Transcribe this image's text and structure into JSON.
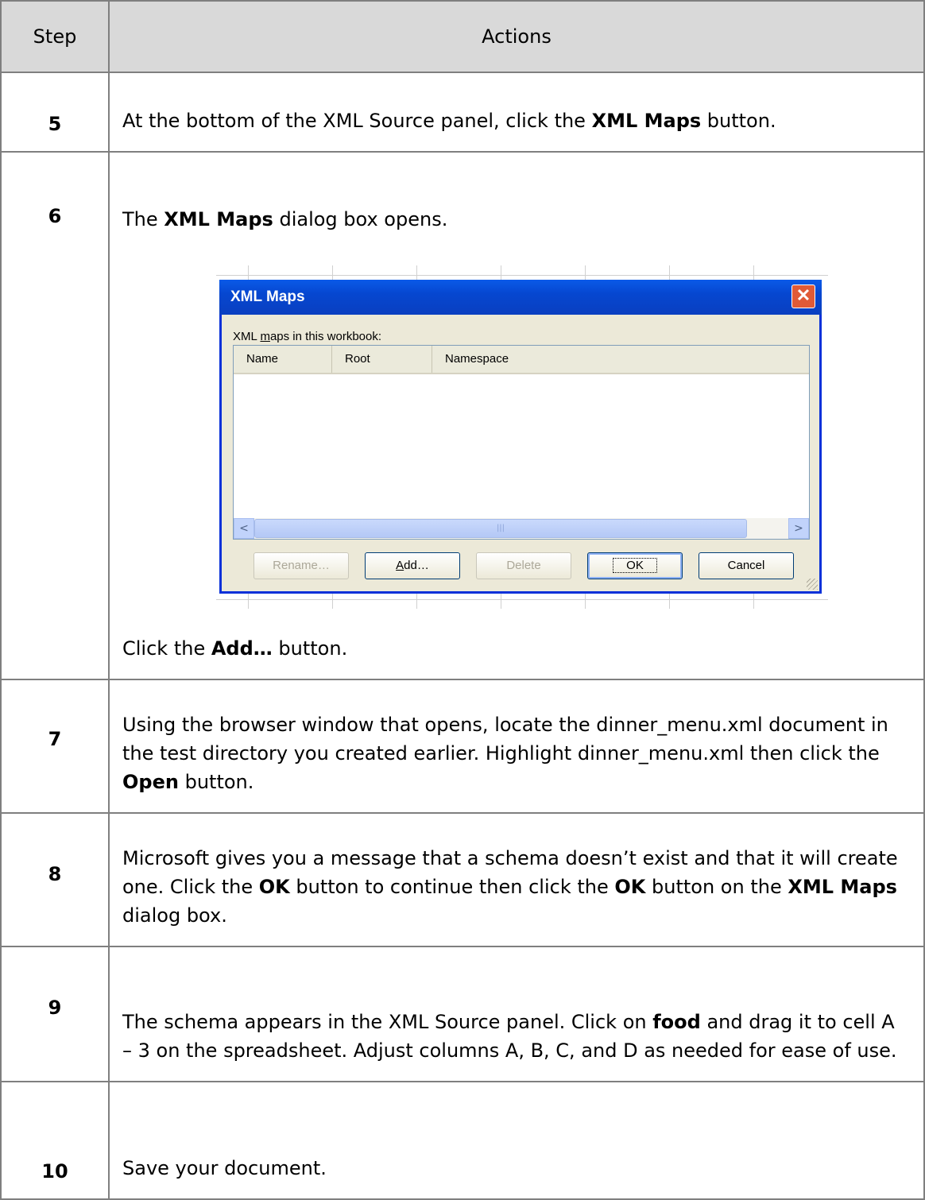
{
  "header": {
    "step": "Step",
    "actions": "Actions"
  },
  "steps": [
    {
      "num": "5",
      "parts": [
        "At the bottom of the XML Source panel, click the ",
        "XML Maps",
        " button."
      ]
    },
    {
      "num": "6",
      "intro": [
        "The ",
        "XML Maps",
        " dialog box opens."
      ],
      "outro": [
        "Click the ",
        "Add…",
        " button."
      ]
    },
    {
      "num": "7",
      "parts": [
        "Using the browser window that opens, locate the dinner_menu.xml document in the test directory you created earlier. Highlight dinner_menu.xml then click the ",
        "Open",
        " button."
      ]
    },
    {
      "num": "8",
      "parts": [
        "Microsoft gives you a message that a schema doesn’t exist and that it will create one. Click the ",
        "OK",
        " button to continue then click the ",
        "OK",
        " button on the ",
        "XML Maps",
        " dialog box."
      ]
    },
    {
      "num": "9",
      "parts": [
        "The schema appears in the XML Source panel. Click on ",
        "food",
        " and drag it to cell A – 3 on the spreadsheet. Adjust columns A, B, C, and D as needed for ease of use."
      ]
    },
    {
      "num": "10",
      "parts": [
        "Save your document."
      ]
    }
  ],
  "dialog": {
    "title": "XML Maps",
    "label_pre": "XML ",
    "label_mnemonic": "m",
    "label_post": "aps in this workbook:",
    "columns": [
      "Name",
      "Root",
      "Namespace"
    ],
    "buttons": {
      "rename": "Rename…",
      "add_mnemonic": "A",
      "add_rest": "dd…",
      "delete": "Delete",
      "ok": "OK",
      "cancel": "Cancel"
    },
    "close_glyph": "✕",
    "scroll_left": "<",
    "scroll_right": ">",
    "scroll_grip": "|||",
    "colors": {
      "title_bar": "#0a5ae8",
      "face": "#ece9d8",
      "close": "#e05a37"
    }
  }
}
